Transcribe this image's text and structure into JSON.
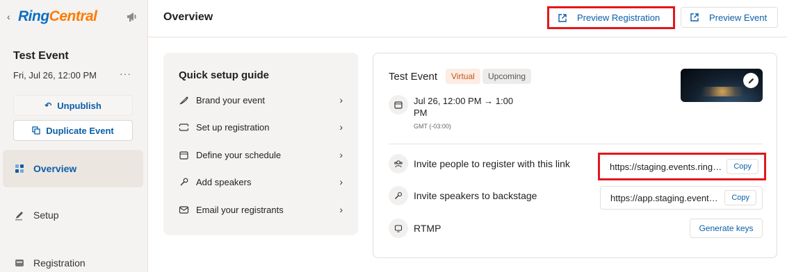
{
  "sidebar": {
    "logo": {
      "ring": "Ring",
      "central": "Central"
    },
    "event_title": "Test Event",
    "event_date": "Fri, Jul 26, 12:00 PM",
    "more": "···",
    "unpublish_label": "Unpublish",
    "duplicate_label": "Duplicate Event",
    "nav": [
      {
        "label": "Overview",
        "active": true
      },
      {
        "label": "Setup",
        "active": false
      },
      {
        "label": "Registration",
        "active": false
      }
    ]
  },
  "header": {
    "title": "Overview",
    "preview_registration": "Preview Registration",
    "preview_event": "Preview Event"
  },
  "quick_setup": {
    "title": "Quick setup guide",
    "items": [
      {
        "label": "Brand your event",
        "icon": "brush-icon"
      },
      {
        "label": "Set up registration",
        "icon": "ticket-icon"
      },
      {
        "label": "Define your schedule",
        "icon": "calendar-icon"
      },
      {
        "label": "Add speakers",
        "icon": "microphone-icon"
      },
      {
        "label": "Email your registrants",
        "icon": "email-icon"
      }
    ]
  },
  "event_card": {
    "title": "Test Event",
    "badge_virtual": "Virtual",
    "badge_upcoming": "Upcoming",
    "time": "Jul 26, 12:00 PM → 1:00 PM",
    "timezone": "GMT (-03:00)",
    "invite_register_label": "Invite people to register with this link",
    "invite_register_url": "https://staging.events.ringcentral.com/events/test-event/registration",
    "invite_speakers_label": "Invite speakers to backstage",
    "invite_speakers_url": "https://app.staging.events.ringcentral.com/backstage",
    "copy_label": "Copy",
    "rtmp_label": "RTMP",
    "generate_keys_label": "Generate keys"
  },
  "colors": {
    "accent": "#0b5ea8",
    "brand_blue": "#0a6fc2",
    "brand_orange": "#ff7a00",
    "highlight": "#e4161b"
  }
}
